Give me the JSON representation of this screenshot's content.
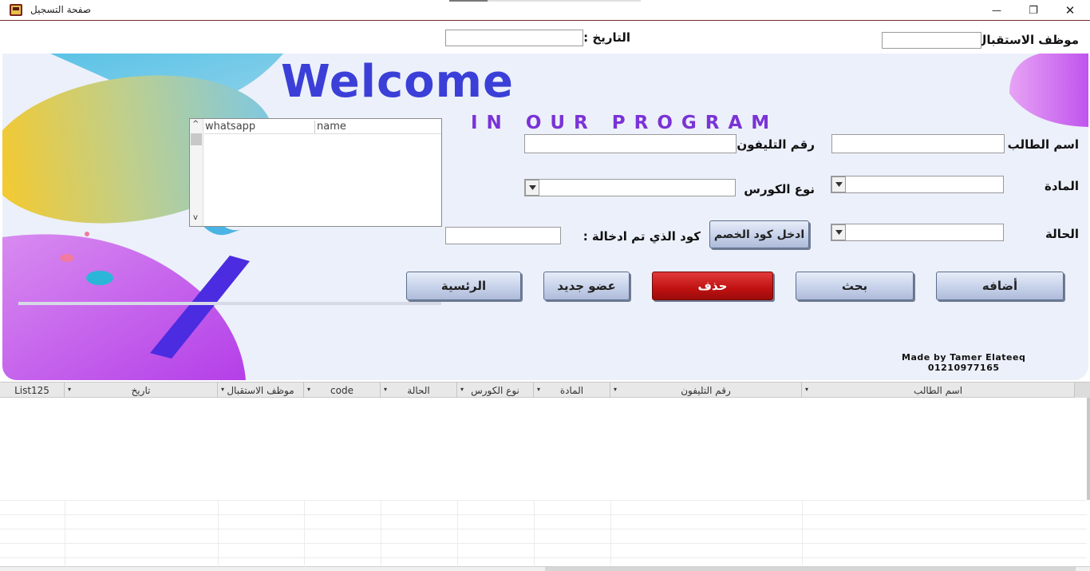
{
  "window": {
    "title": "صفحة التسجيل",
    "minimize_glyph": "—",
    "restore_glyph": "❐",
    "close_glyph": "✕"
  },
  "header": {
    "receptionist_label": "موظف الاستقبال :",
    "date_label": "التاريخ :",
    "receptionist_value": "",
    "date_value": ""
  },
  "banner": {
    "welcome": "Welcome",
    "subtitle": "IN OUR PROGRAM",
    "credit_line1": "Made by Tamer Elateeq",
    "credit_line2": "01210977165"
  },
  "form": {
    "student_name_label": "اسم الطالب",
    "phone_label": "رقم التليفون",
    "subject_label": "المادة",
    "course_type_label": "نوع الكورس",
    "status_label": "الحالة",
    "entered_code_label": "كود الذي تم ادخالة :",
    "student_name_value": "",
    "phone_value": "",
    "subject_value": "",
    "course_type_value": "",
    "status_value": "",
    "entered_code_value": ""
  },
  "buttons": {
    "discount_code": "ادخل كود الخصم",
    "add": "أضافه",
    "search": "بحث",
    "delete": "حذف",
    "new_member": "عضو جديد",
    "home": "الرئسية"
  },
  "listbox": {
    "columns": [
      "whatsapp",
      "name"
    ],
    "scroll_up": "^",
    "scroll_down": "v"
  },
  "grid": {
    "columns": [
      "اسم الطالب",
      "رقم التليفون",
      "المادة",
      "نوع الكورس",
      "الحالة",
      "code",
      "موظف الاستقبال",
      "تاريخ",
      "List125"
    ],
    "dropdown_glyph": "▾"
  },
  "colors": {
    "welcome": "#3b3fd8",
    "program": "#7a33d6",
    "delete_button": "#c01111"
  }
}
